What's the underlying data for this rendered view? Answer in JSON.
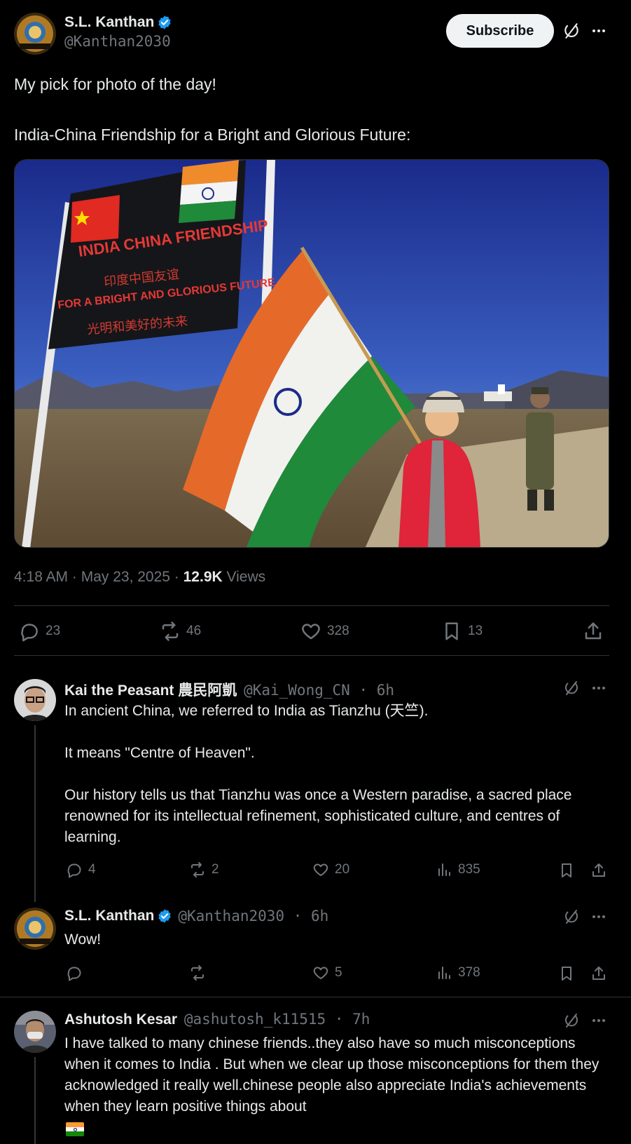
{
  "main_post": {
    "author": {
      "name": "S.L. Kanthan",
      "handle": "@Kanthan2030"
    },
    "subscribe_label": "Subscribe",
    "text": "My pick for photo of the day!\n\nIndia-China Friendship for a Bright and Glorious Future:",
    "image": {
      "sign_line1": "INDIA CHINA FRIENDSHIP",
      "sign_line2": "印度中国友谊",
      "sign_line3": "FOR A BRIGHT AND GLORIOUS FUTURE",
      "sign_line4": "光明和美好的未来"
    },
    "meta": {
      "time": "4:18 AM · May 23, 2025 · ",
      "views_count": "12.9K",
      "views_label": " Views"
    },
    "stats": {
      "replies": "23",
      "reposts": "46",
      "likes": "328",
      "bookmarks": "13"
    }
  },
  "replies": [
    {
      "name": "Kai the Peasant 農民阿凱",
      "handle_time": "@Kai_Wong_CN · 6h",
      "text": "In ancient China, we referred to India as Tianzhu (天竺).\n\nIt means \"Centre of Heaven\".\n\nOur history tells us that Tianzhu was once a Western paradise, a sacred place renowned for its intellectual refinement, sophisticated culture, and centres of learning.",
      "stats": {
        "replies": "4",
        "reposts": "2",
        "likes": "20",
        "views": "835"
      }
    },
    {
      "name": "S.L. Kanthan",
      "handle_time": "@Kanthan2030 · 6h",
      "text": "Wow!",
      "stats": {
        "replies": "",
        "reposts": "",
        "likes": "5",
        "views": "378"
      }
    },
    {
      "name": "Ashutosh Kesar",
      "handle_time": "@ashutosh_k11515 · 7h",
      "text": "I have talked to many chinese friends..they also have so much misconceptions when it comes to India . But when we clear up those misconceptions for them they acknowledged it really well.chinese people also appreciate India's achievements when they learn positive things about"
    }
  ],
  "colors": {
    "background": "#000000",
    "text": "#e7e9ea",
    "muted": "#71767b",
    "verified": "#1d9bf0",
    "divider": "#2f3336"
  },
  "icons": [
    "verified-badge-icon",
    "grok-icon",
    "more-icon",
    "reply-icon",
    "repost-icon",
    "like-icon",
    "bookmark-icon",
    "share-icon",
    "views-icon",
    "india-flag-emoji"
  ]
}
